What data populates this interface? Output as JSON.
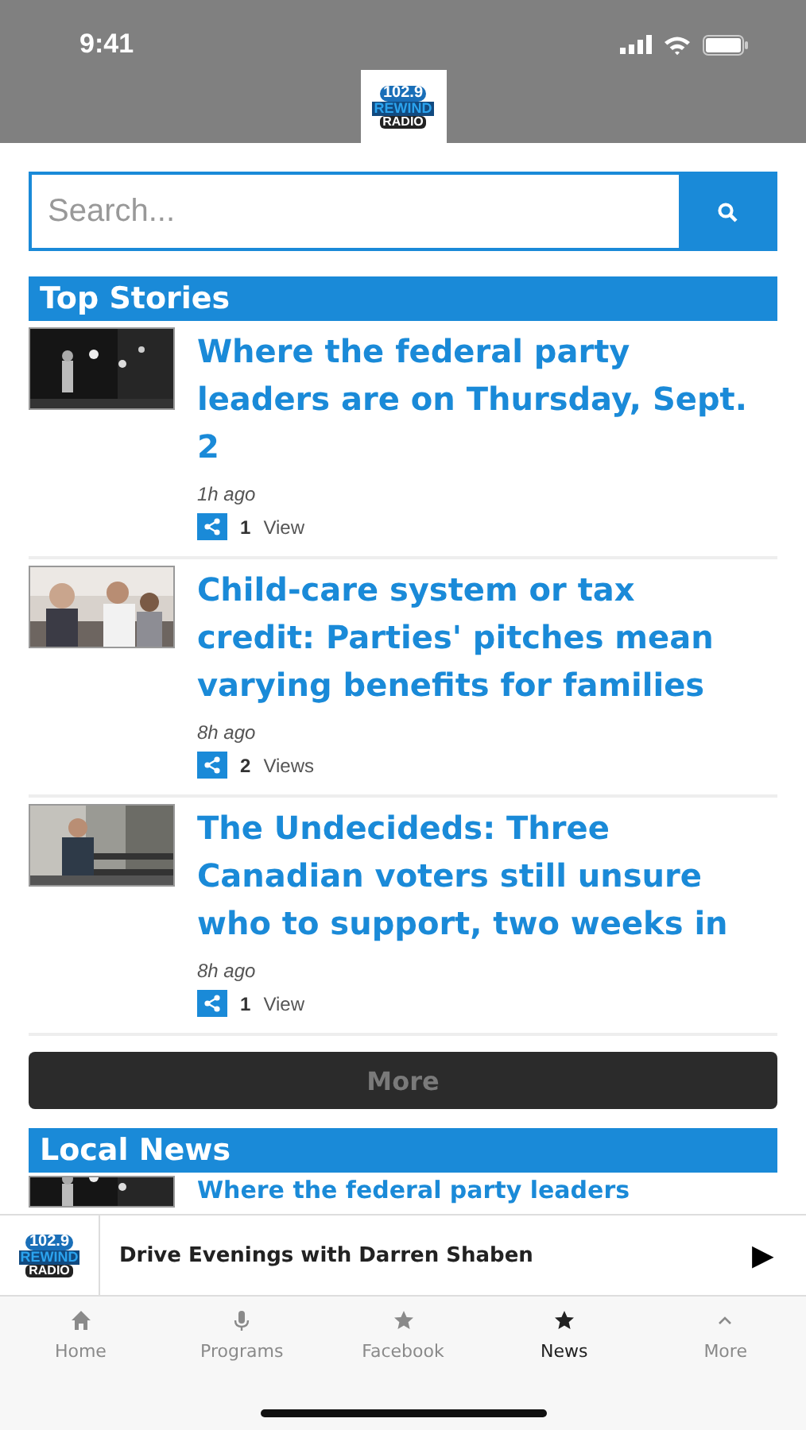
{
  "status_bar": {
    "time": "9:41"
  },
  "header": {
    "logo": {
      "frequency": "102.9",
      "name": "REWIND",
      "tagline": "RADIO"
    }
  },
  "search": {
    "placeholder": "Search..."
  },
  "sections": [
    {
      "title": "Top Stories",
      "articles": [
        {
          "headline": "Where the federal party leaders are on Thursday, Sept. 2",
          "time": "1h ago",
          "views_count": "1",
          "views_label": "View"
        },
        {
          "headline": "Child-care system or tax credit: Parties' pitches mean varying benefits for families",
          "time": "8h ago",
          "views_count": "2",
          "views_label": "Views"
        },
        {
          "headline": "The Undecideds: Three Canadian voters still unsure who to support, two weeks in",
          "time": "8h ago",
          "views_count": "1",
          "views_label": "View"
        }
      ],
      "more_button": "More"
    },
    {
      "title": "Local News",
      "articles": [
        {
          "headline": "Where the federal party leaders"
        }
      ]
    }
  ],
  "player": {
    "logo": {
      "frequency": "102.9",
      "name": "REWIND",
      "tagline": "RADIO"
    },
    "title": "Drive Evenings with Darren Shaben",
    "play_icon": "▶"
  },
  "tabs": [
    {
      "label": "Home",
      "selected": false
    },
    {
      "label": "Programs",
      "selected": false
    },
    {
      "label": "Facebook",
      "selected": false
    },
    {
      "label": "News",
      "selected": true
    },
    {
      "label": "More",
      "selected": false
    }
  ]
}
